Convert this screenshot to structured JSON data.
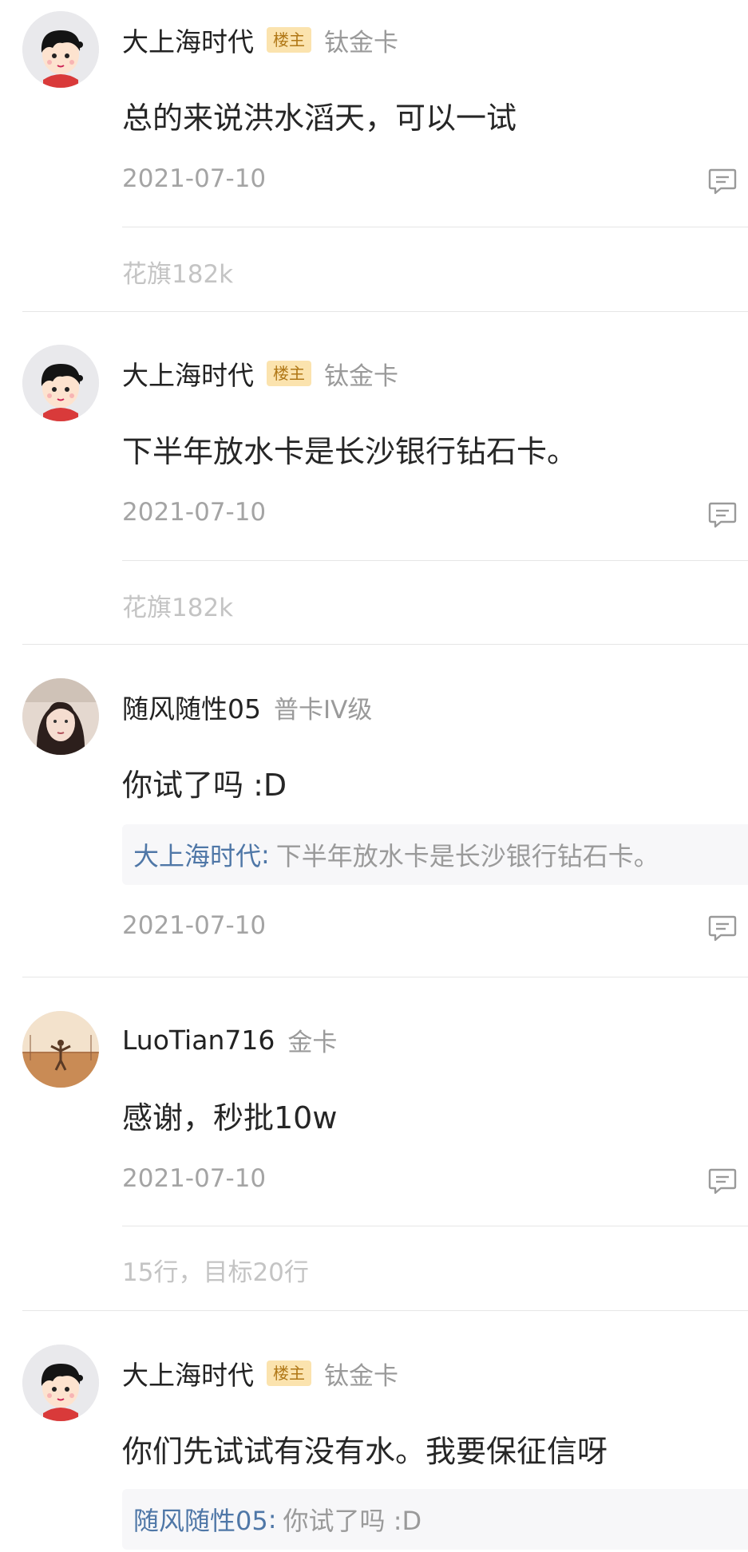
{
  "posts": [
    {
      "username": "大上海时代",
      "host_badge": "楼主",
      "card_level": "钛金卡",
      "content": "总的来说洪水滔天，可以一试",
      "date": "2021-07-10",
      "signature": "花旗182k"
    },
    {
      "username": "大上海时代",
      "host_badge": "楼主",
      "card_level": "钛金卡",
      "content": "下半年放水卡是长沙银行钻石卡。",
      "date": "2021-07-10",
      "signature": "花旗182k"
    },
    {
      "username": "随风随性05",
      "card_level": "普卡IV级",
      "content": "你试了吗 :D",
      "quote": {
        "author": "大上海时代",
        "colon": ":",
        "text": "下半年放水卡是长沙银行钻石卡。"
      },
      "date": "2021-07-10"
    },
    {
      "username": "LuoTian716",
      "card_level": "金卡",
      "content": "感谢，秒批10w",
      "date": "2021-07-10",
      "signature": "15行，目标20行"
    },
    {
      "username": "大上海时代",
      "host_badge": "楼主",
      "card_level": "钛金卡",
      "content": "你们先试试有没有水。我要保征信呀",
      "quote": {
        "author": "随风随性05",
        "colon": ":",
        "text": "你试了吗 :D"
      }
    }
  ],
  "icons": {
    "reply": "comment-icon",
    "avatar_default": "cartoon-avatar-icon"
  },
  "colors": {
    "host_badge_bg": "#fbe3ae",
    "host_badge_text": "#b07716",
    "quote_author": "#4f77a7",
    "meta_text": "#a4a4a4"
  }
}
